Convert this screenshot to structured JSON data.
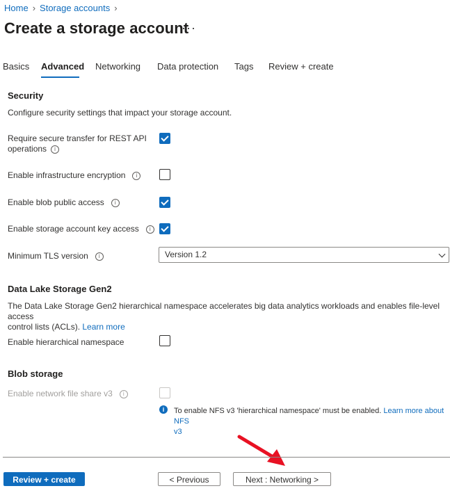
{
  "breadcrumb": {
    "home": "Home",
    "storage_accounts": "Storage accounts"
  },
  "page": {
    "title": "Create a storage account",
    "more": "···"
  },
  "tabs": [
    "Basics",
    "Advanced",
    "Networking",
    "Data protection",
    "Tags",
    "Review + create"
  ],
  "active_tab": "Advanced",
  "security": {
    "title": "Security",
    "description": "Configure security settings that impact your storage account.",
    "require_secure_transfer": {
      "label_line1": "Require secure transfer for REST API",
      "label_line2": "operations",
      "checked": true
    },
    "infrastructure_encryption": {
      "label": "Enable infrastructure encryption",
      "checked": false
    },
    "blob_public_access": {
      "label": "Enable blob public access",
      "checked": true
    },
    "storage_key_access": {
      "label": "Enable storage account key access",
      "checked": true
    },
    "min_tls": {
      "label": "Minimum TLS version",
      "value": "Version 1.2"
    }
  },
  "data_lake": {
    "title": "Data Lake Storage Gen2",
    "description_line1": "The Data Lake Storage Gen2 hierarchical namespace accelerates big data analytics workloads and enables file-level access",
    "description_line2": "control lists (ACLs).",
    "learn_more": "Learn more",
    "hierarchical_namespace": {
      "label": "Enable hierarchical namespace",
      "checked": false
    }
  },
  "blob_storage": {
    "title": "Blob storage",
    "nfs": {
      "label": "Enable network file share v3",
      "checked": false,
      "disabled": true
    },
    "nfs_info_text": "To enable NFS v3 'hierarchical namespace' must be enabled.",
    "nfs_info_link_line1": "Learn more about NFS",
    "nfs_info_link_line2": "v3"
  },
  "footer": {
    "review_create": "Review + create",
    "previous": "< Previous",
    "next": "Next : Networking >"
  },
  "info_glyph": "i",
  "colors": {
    "accent": "#0f6cbd",
    "annotation_arrow": "#e81123"
  }
}
